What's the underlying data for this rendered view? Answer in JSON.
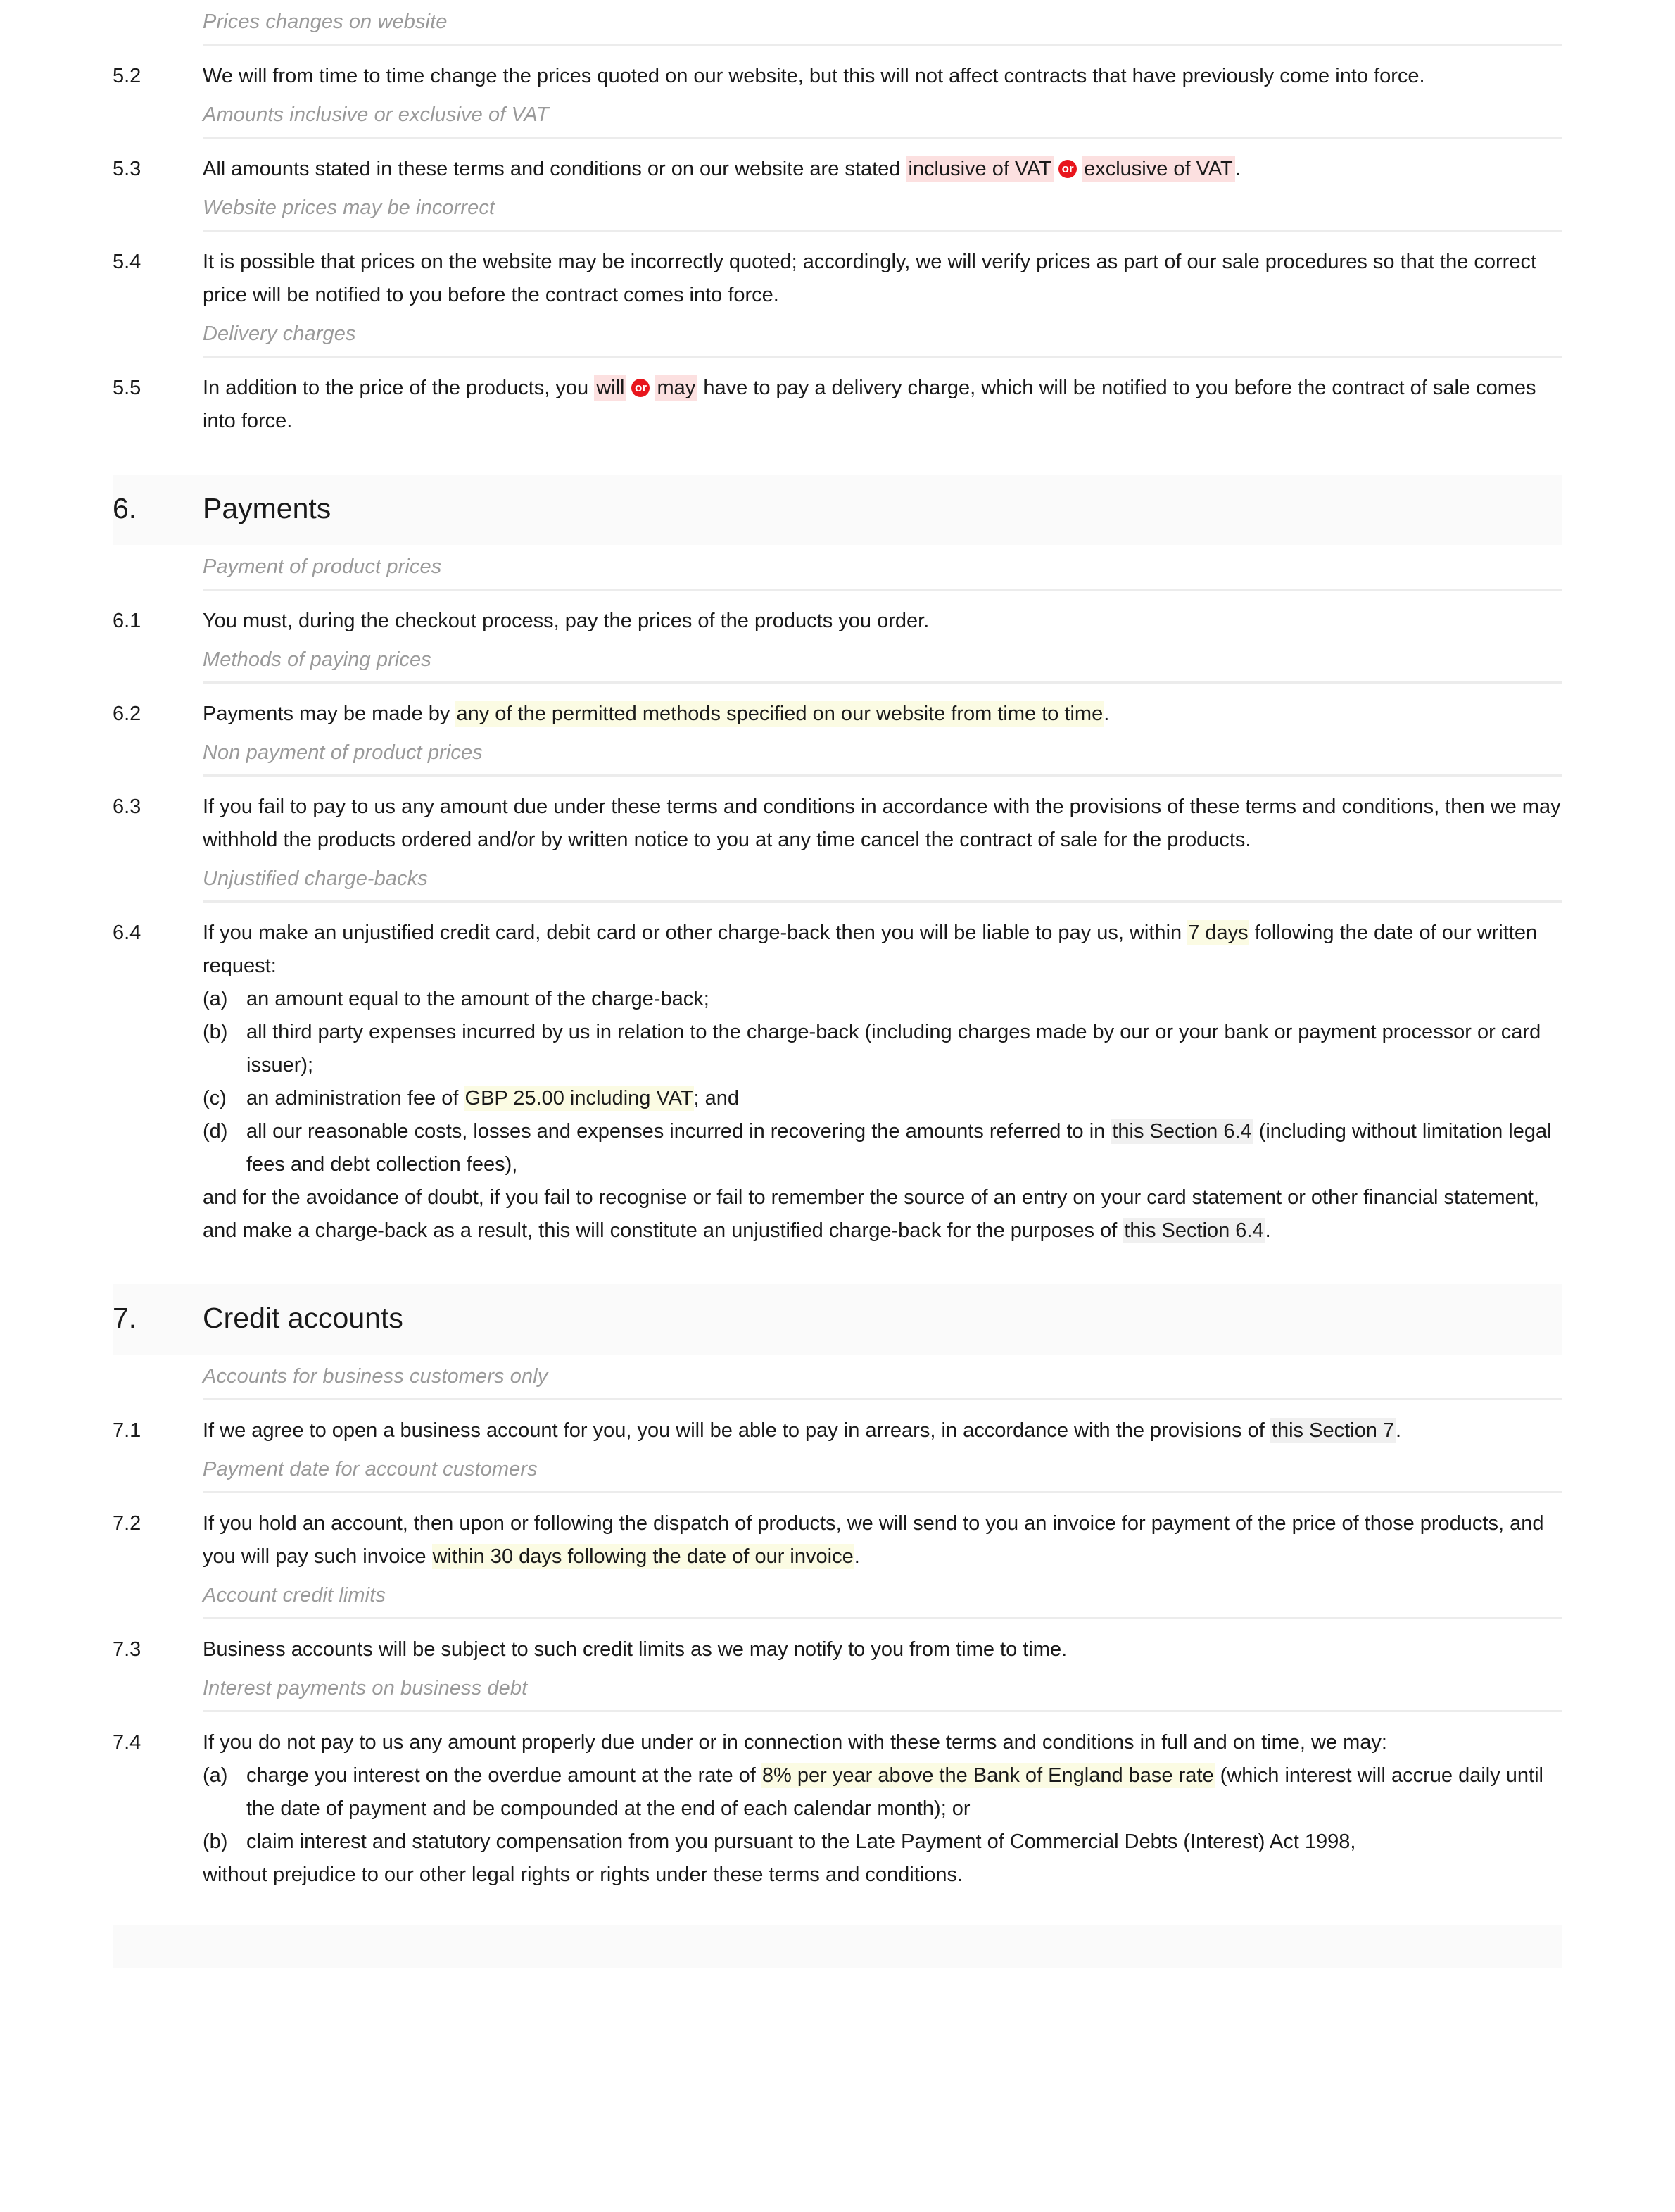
{
  "document": {
    "type": "terms-and-conditions",
    "highlight_colors": {
      "variable_yellow": "#fbfbe3",
      "alternative_pink": "#fce0e0",
      "cross_reference_gray": "#f0f0f0",
      "or_badge_red": "#e8161d",
      "section_band": "#fafafa",
      "rule": "#ececec",
      "caption_text": "#9a9a9a"
    },
    "or_badge_label": "or"
  },
  "blocks": [
    {
      "caption": "Prices changes on website",
      "number": "5.2",
      "text_parts": [
        {
          "t": "We will from time to time change the prices quoted on our website, but this will not affect contracts that have previously come into force.",
          "hl": "none"
        }
      ]
    },
    {
      "caption": "Amounts inclusive or exclusive of VAT",
      "number": "5.3",
      "text_parts": [
        {
          "t": "All amounts stated in these terms and conditions or on our website are stated ",
          "hl": "none"
        },
        {
          "t": "inclusive of VAT",
          "hl": "pink"
        },
        {
          "t": "or",
          "hl": "badge"
        },
        {
          "t": "exclusive of VAT",
          "hl": "pink"
        },
        {
          "t": ".",
          "hl": "none"
        }
      ]
    },
    {
      "caption": "Website prices may be incorrect",
      "number": "5.4",
      "text_parts": [
        {
          "t": "It is possible that prices on the website may be incorrectly quoted; accordingly, we will verify prices as part of our sale procedures so that the correct price will be notified to you before the contract comes into force.",
          "hl": "none"
        }
      ]
    },
    {
      "caption": "Delivery charges",
      "number": "5.5",
      "text_parts": [
        {
          "t": "In addition to the price of the products, you ",
          "hl": "none"
        },
        {
          "t": "will",
          "hl": "pink"
        },
        {
          "t": "or",
          "hl": "badge"
        },
        {
          "t": "may",
          "hl": "pink"
        },
        {
          "t": " have to pay a delivery charge, which will be notified to you before the contract of sale comes into force.",
          "hl": "none"
        }
      ]
    }
  ],
  "section_six": {
    "number": "6.",
    "title": "Payments",
    "blocks": [
      {
        "caption": "Payment of product prices",
        "number": "6.1",
        "text_parts": [
          {
            "t": "You must, during the checkout process, pay the prices of the products you order.",
            "hl": "none"
          }
        ]
      },
      {
        "caption": "Methods of paying prices",
        "number": "6.2",
        "text_parts": [
          {
            "t": "Payments may be made by ",
            "hl": "none"
          },
          {
            "t": "any of the permitted methods specified on our website from time to time",
            "hl": "yellow"
          },
          {
            "t": ".",
            "hl": "none"
          }
        ]
      },
      {
        "caption": "Non payment of product prices",
        "number": "6.3",
        "text_parts": [
          {
            "t": "If you fail to pay to us any amount due under these terms and conditions in accordance with the provisions of these terms and conditions, then we may withhold the products ordered and/or by written notice to you at any time cancel the contract of sale for the products.",
            "hl": "none"
          }
        ]
      }
    ]
  },
  "clause_64": {
    "caption": "Unjustified charge-backs",
    "number": "6.4",
    "lead_parts": [
      {
        "t": "If you make an unjustified credit card, debit card or other charge-back then you will be liable to pay us, within ",
        "hl": "none"
      },
      {
        "t": "7 days",
        "hl": "yellow"
      },
      {
        "t": " following the date of our written request:",
        "hl": "none"
      }
    ],
    "items": [
      {
        "marker": "(a)",
        "parts": [
          {
            "t": "an amount equal to the amount of the charge-back;",
            "hl": "none"
          }
        ]
      },
      {
        "marker": "(b)",
        "parts": [
          {
            "t": "all third party expenses incurred by us in relation to the charge-back (including charges made by our or your bank or payment processor or card issuer);",
            "hl": "none"
          }
        ]
      },
      {
        "marker": "(c)",
        "parts": [
          {
            "t": "an administration fee of ",
            "hl": "none"
          },
          {
            "t": "GBP 25.00 including VAT",
            "hl": "yellow"
          },
          {
            "t": "; and",
            "hl": "none"
          }
        ]
      },
      {
        "marker": "(d)",
        "parts": [
          {
            "t": "all our reasonable costs, losses and expenses incurred in recovering the amounts referred to in ",
            "hl": "none"
          },
          {
            "t": "this Section 6.4",
            "hl": "gray"
          },
          {
            "t": " (including without limitation legal fees and debt collection fees),",
            "hl": "none"
          }
        ]
      }
    ],
    "trailing_parts": [
      {
        "t": "and for the avoidance of doubt, if you fail to recognise or fail to remember the source of an entry on your card statement or other financial statement, and make a charge-back as a result, this will constitute an unjustified charge-back for the purposes of ",
        "hl": "none"
      },
      {
        "t": "this Section 6.4",
        "hl": "gray"
      },
      {
        "t": ".",
        "hl": "none"
      }
    ]
  },
  "section_seven": {
    "number": "7.",
    "title": "Credit accounts",
    "blocks": [
      {
        "caption": "Accounts for business customers only",
        "number": "7.1",
        "text_parts": [
          {
            "t": "If we agree to open a business account for you, you will be able to pay in arrears, in accordance with the provisions of ",
            "hl": "none"
          },
          {
            "t": "this Section 7",
            "hl": "gray"
          },
          {
            "t": ".",
            "hl": "none"
          }
        ]
      },
      {
        "caption": "Payment date for account customers",
        "number": "7.2",
        "text_parts": [
          {
            "t": "If you hold an account, then upon or following the dispatch of products, we will send to you an invoice for payment of the price of those products, and you will pay such invoice ",
            "hl": "none"
          },
          {
            "t": "within 30 days following the date of our invoice",
            "hl": "yellow"
          },
          {
            "t": ".",
            "hl": "none"
          }
        ]
      },
      {
        "caption": "Account credit limits",
        "number": "7.3",
        "text_parts": [
          {
            "t": "Business accounts will be subject to such credit limits as we may notify to you from time to time.",
            "hl": "none"
          }
        ]
      }
    ]
  },
  "clause_74": {
    "caption": "Interest payments on business debt",
    "number": "7.4",
    "lead_parts": [
      {
        "t": "If you do not pay to us any amount properly due under or in connection with these terms and conditions in full and on time, we may:",
        "hl": "none"
      }
    ],
    "items": [
      {
        "marker": "(a)",
        "parts": [
          {
            "t": "charge you interest on the overdue amount at the rate of ",
            "hl": "none"
          },
          {
            "t": "8% per year above the Bank of England base rate",
            "hl": "yellow"
          },
          {
            "t": " (which interest will accrue daily until the date of payment and be compounded at the end of each calendar month); or",
            "hl": "none"
          }
        ]
      },
      {
        "marker": "(b)",
        "parts": [
          {
            "t": "claim interest and statutory compensation from you pursuant to the Late Payment of Commercial Debts (Interest) Act 1998,",
            "hl": "none"
          }
        ]
      }
    ],
    "trailing_parts": [
      {
        "t": "without prejudice to our other legal rights or rights under these terms and conditions.",
        "hl": "none"
      }
    ]
  }
}
